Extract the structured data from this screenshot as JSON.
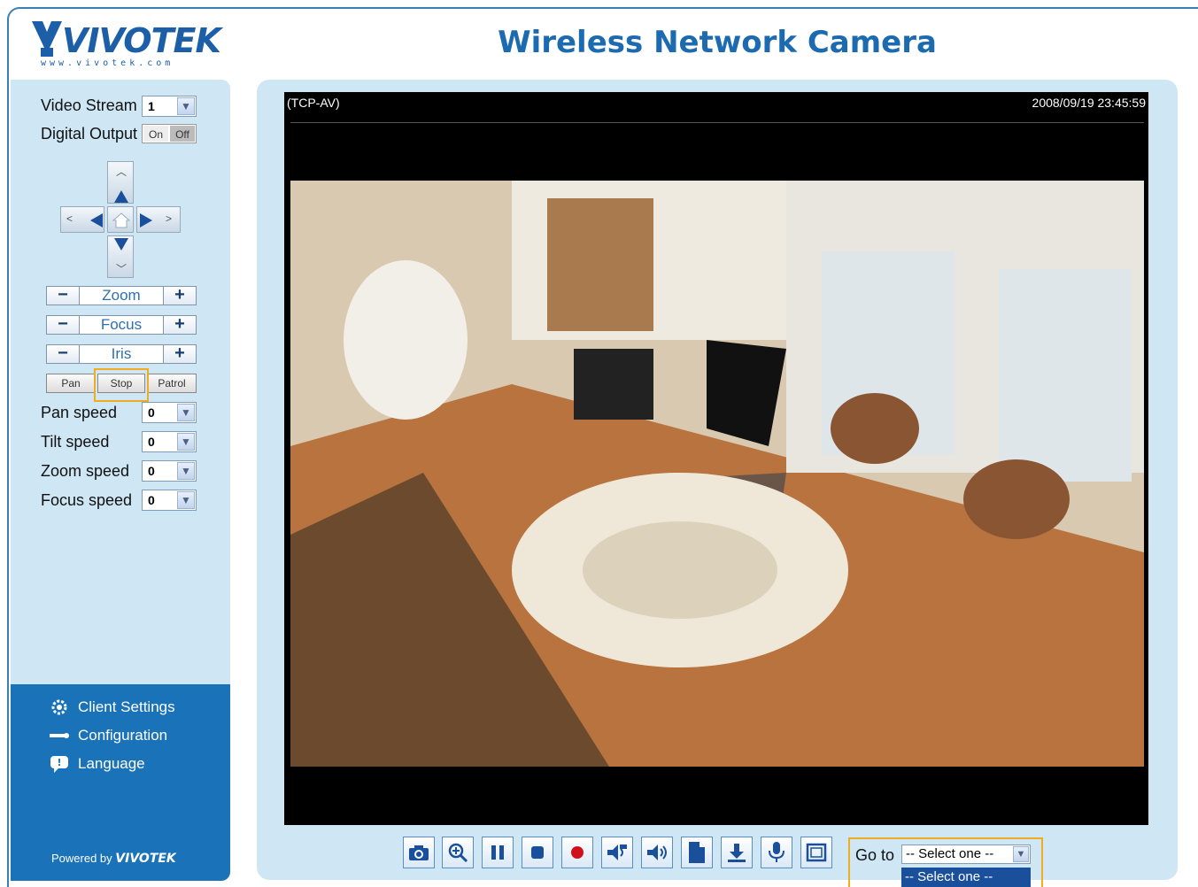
{
  "header": {
    "brand": "VIVOTEK",
    "brand_url": "www.vivotek.com",
    "title": "Wireless Network Camera"
  },
  "sidebar": {
    "video_stream_label": "Video Stream",
    "video_stream_value": "1",
    "digital_output_label": "Digital Output",
    "on_label": "On",
    "off_label": "Off",
    "zoom_label": "Zoom",
    "focus_label": "Focus",
    "iris_label": "Iris",
    "pan_label": "Pan",
    "stop_label": "Stop",
    "patrol_label": "Patrol",
    "pan_speed_label": "Pan speed",
    "pan_speed_value": "0",
    "tilt_speed_label": "Tilt speed",
    "tilt_speed_value": "0",
    "zoom_speed_label": "Zoom speed",
    "zoom_speed_value": "0",
    "focus_speed_label": "Focus speed",
    "focus_speed_value": "0",
    "links": [
      "Client Settings",
      "Configuration",
      "Language"
    ],
    "powered_by": "Powered by",
    "powered_brand": "VIVOTEK"
  },
  "video": {
    "protocol": "(TCP-AV)",
    "timestamp": "2008/09/19 23:45:59"
  },
  "toolbar": {
    "icons": [
      "snapshot-icon",
      "digital-zoom-icon",
      "pause-icon",
      "stop-icon",
      "record-icon",
      "volume-icon",
      "mute-icon",
      "file-icon",
      "download-icon",
      "microphone-icon",
      "fullscreen-icon"
    ],
    "goto_label": "Go to",
    "goto_value": "-- Select one --",
    "goto_option": "-- Select one --"
  },
  "colors": {
    "brand": "#1c5ea8",
    "panel": "#cfe6f5",
    "highlight": "#f1ad1d"
  }
}
